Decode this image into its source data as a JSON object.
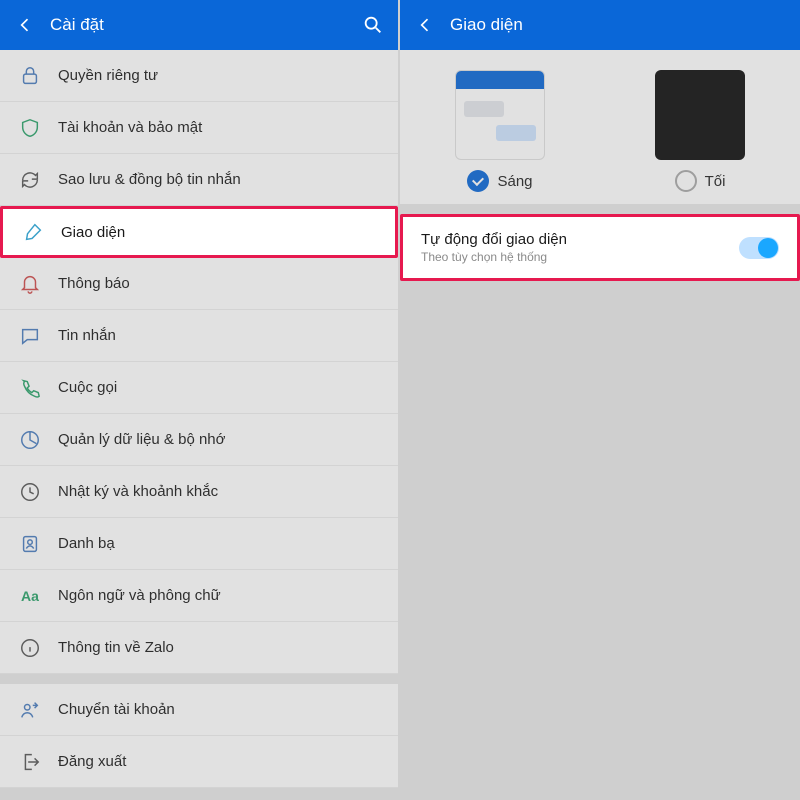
{
  "left": {
    "header_title": "Cài đặt",
    "items": [
      {
        "id": "privacy",
        "label": "Quyền riêng tư"
      },
      {
        "id": "account-security",
        "label": "Tài khoản và bảo mật"
      },
      {
        "id": "backup-sync",
        "label": "Sao lưu & đồng bộ tin nhắn"
      },
      {
        "id": "interface",
        "label": "Giao diện"
      },
      {
        "id": "notifications",
        "label": "Thông báo"
      },
      {
        "id": "messages",
        "label": "Tin nhắn"
      },
      {
        "id": "calls",
        "label": "Cuộc gọi"
      },
      {
        "id": "data-storage",
        "label": "Quản lý dữ liệu & bộ nhớ"
      },
      {
        "id": "diary-moments",
        "label": "Nhật ký và khoảnh khắc"
      },
      {
        "id": "contacts",
        "label": "Danh bạ"
      },
      {
        "id": "language-font",
        "label": "Ngôn ngữ và phông chữ"
      },
      {
        "id": "about",
        "label": "Thông tin về Zalo"
      },
      {
        "id": "switch-account",
        "label": "Chuyển tài khoản"
      },
      {
        "id": "logout",
        "label": "Đăng xuất"
      }
    ]
  },
  "right": {
    "header_title": "Giao diện",
    "theme": {
      "light_label": "Sáng",
      "dark_label": "Tối",
      "selected": "light"
    },
    "auto": {
      "title": "Tự động đổi giao diện",
      "subtitle": "Theo tùy chọn hệ thống",
      "enabled": true
    }
  },
  "colors": {
    "primary": "#0a67d8",
    "highlight": "#e6194f"
  }
}
